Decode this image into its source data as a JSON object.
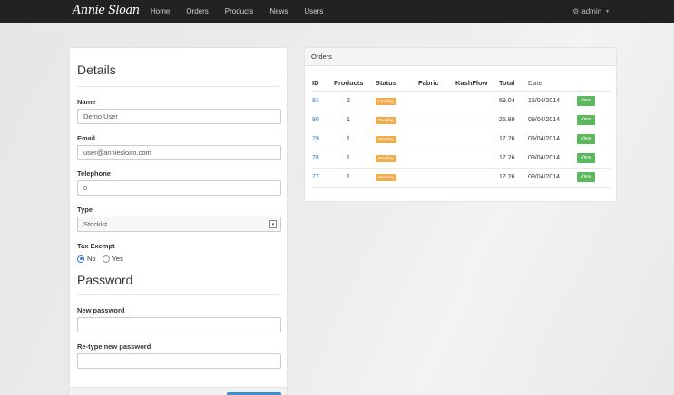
{
  "brand": {
    "logo_text": "Annie Sloan"
  },
  "nav": {
    "links": [
      "Home",
      "Orders",
      "Products",
      "News",
      "Users"
    ],
    "user": "admin"
  },
  "details": {
    "title": "Details",
    "name_label": "Name",
    "name_value": "Demo User",
    "email_label": "Email",
    "email_value": "user@anniesloan.com",
    "telephone_label": "Telephone",
    "telephone_value": "0",
    "type_label": "Type",
    "type_value": "Stockist",
    "tax_label": "Tax Exempt",
    "tax_options": [
      "No",
      "Yes"
    ],
    "tax_selected": "No"
  },
  "password": {
    "title": "Password",
    "new_label": "New password",
    "retype_label": "Re-type new password"
  },
  "orders": {
    "title": "Orders",
    "columns": [
      "ID",
      "Products",
      "Status",
      "Fabric",
      "KashFlow",
      "Total",
      "Date"
    ],
    "rows": [
      {
        "id": "81",
        "products": "2",
        "status": "Pending",
        "fabric": "",
        "kashflow": "",
        "total": "69.04",
        "date": "15/04/2014",
        "action": "View"
      },
      {
        "id": "80",
        "products": "1",
        "status": "Pending",
        "fabric": "",
        "kashflow": "",
        "total": "25.89",
        "date": "09/04/2014",
        "action": "View"
      },
      {
        "id": "79",
        "products": "1",
        "status": "Pending",
        "fabric": "",
        "kashflow": "",
        "total": "17.26",
        "date": "09/04/2014",
        "action": "View"
      },
      {
        "id": "78",
        "products": "1",
        "status": "Pending",
        "fabric": "",
        "kashflow": "",
        "total": "17.26",
        "date": "09/04/2014",
        "action": "View"
      },
      {
        "id": "77",
        "products": "1",
        "status": "Pending",
        "fabric": "",
        "kashflow": "",
        "total": "17.26",
        "date": "09/04/2014",
        "action": "View"
      }
    ]
  },
  "colors": {
    "navbar": "#222222",
    "link": "#2a7ab8",
    "pending": "#f0ad4e",
    "view_button": "#5cb85c",
    "primary_button": "#3d8fd1"
  }
}
